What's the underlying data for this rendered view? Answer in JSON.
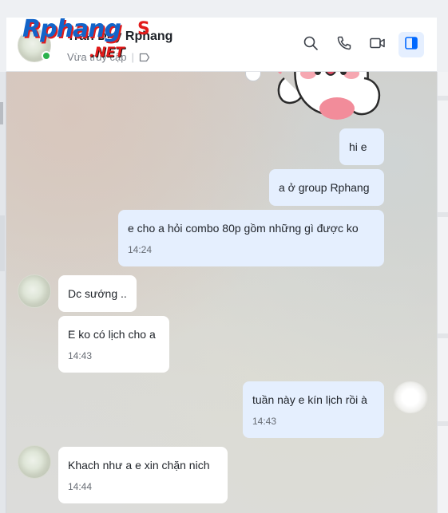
{
  "header": {
    "contact_name": "Trần Duy Rphang",
    "status": "Vừa truy cập",
    "logo_main": "Rphang",
    "logo_suffix": "S",
    "logo_net": ".NET"
  },
  "icons": {
    "search": "search-icon",
    "call": "phone-icon",
    "video": "video-icon",
    "panel": "sidebar-toggle-icon",
    "tag": "tag-icon"
  },
  "colors": {
    "accent": "#0068ff",
    "online": "#2bb24c",
    "my_bubble": "#e5effe",
    "their_bubble": "#ffffff"
  },
  "messages": [
    {
      "sender": "me",
      "text": "hi e",
      "time": ""
    },
    {
      "sender": "me",
      "text": "a ở group Rphang",
      "time": ""
    },
    {
      "sender": "me",
      "text": "e cho a hỏi combo 80p gồm những gì được ko",
      "time": "14:24"
    },
    {
      "sender": "them",
      "text": "Dc sướng ..",
      "time": ""
    },
    {
      "sender": "them",
      "text": "E ko có lịch cho a",
      "time": "14:43"
    },
    {
      "sender": "me",
      "text": "tuần này e kín lịch rồi à",
      "time": "14:43"
    },
    {
      "sender": "them",
      "text": "Khach như a e xin chặn nich",
      "time": "14:44"
    }
  ]
}
